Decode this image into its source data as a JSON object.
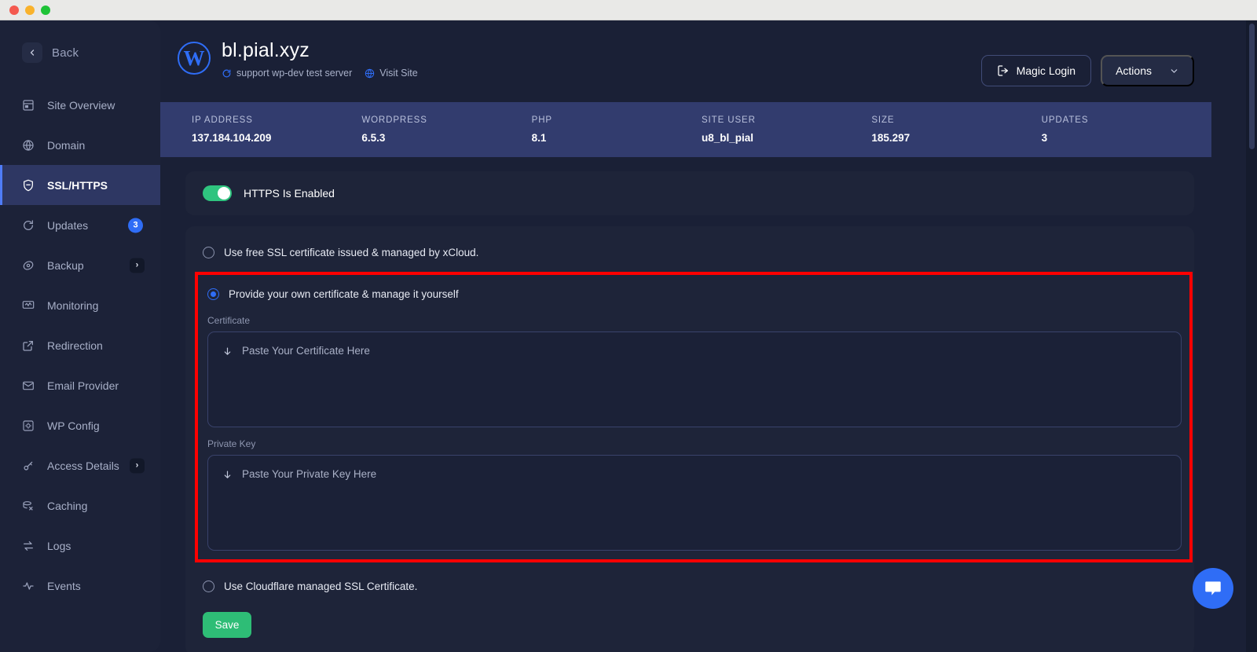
{
  "window": {
    "traffic_lights": [
      "close",
      "minimize",
      "maximize"
    ]
  },
  "sidebar": {
    "back_label": "Back",
    "items": [
      {
        "label": "Site Overview",
        "icon": "site-overview-icon",
        "active": false
      },
      {
        "label": "Domain",
        "icon": "domain-icon",
        "active": false
      },
      {
        "label": "SSL/HTTPS",
        "icon": "shield-icon",
        "active": true
      },
      {
        "label": "Updates",
        "icon": "refresh-icon",
        "active": false,
        "badge": "3"
      },
      {
        "label": "Backup",
        "icon": "backup-icon",
        "active": false,
        "chevron": "›"
      },
      {
        "label": "Monitoring",
        "icon": "monitoring-icon",
        "active": false
      },
      {
        "label": "Redirection",
        "icon": "external-link-icon",
        "active": false
      },
      {
        "label": "Email Provider",
        "icon": "envelope-icon",
        "active": false
      },
      {
        "label": "WP Config",
        "icon": "wp-config-icon",
        "active": false
      },
      {
        "label": "Access Details",
        "icon": "key-icon",
        "active": false,
        "chevron": "›"
      },
      {
        "label": "Caching",
        "icon": "caching-icon",
        "active": false
      },
      {
        "label": "Logs",
        "icon": "logs-icon",
        "active": false
      },
      {
        "label": "Events",
        "icon": "events-icon",
        "active": false
      }
    ]
  },
  "header": {
    "site_title": "bl.pial.xyz",
    "server_label": "support wp-dev test server",
    "visit_site_label": "Visit Site",
    "magic_login_label": "Magic Login",
    "actions_label": "Actions",
    "actions_chevron": "∨"
  },
  "stats": [
    {
      "label": "IP ADDRESS",
      "value": "137.184.104.209"
    },
    {
      "label": "WORDPRESS",
      "value": "6.5.3"
    },
    {
      "label": "PHP",
      "value": "8.1"
    },
    {
      "label": "SITE USER",
      "value": "u8_bl_pial"
    },
    {
      "label": "SIZE",
      "value": "185.297"
    },
    {
      "label": "UPDATES",
      "value": "3"
    }
  ],
  "https_card": {
    "toggle_state": "on",
    "label": "HTTPS Is Enabled"
  },
  "ssl_card": {
    "option_free": "Use free SSL certificate issued & managed by xCloud.",
    "option_own": "Provide your own certificate & manage it yourself",
    "option_cloudflare": "Use Cloudflare managed SSL Certificate.",
    "certificate_label": "Certificate",
    "certificate_placeholder": "Paste Your Certificate Here",
    "certificate_value": "",
    "private_key_label": "Private Key",
    "private_key_placeholder": "Paste Your Private Key Here",
    "private_key_value": "",
    "save_label": "Save",
    "selected_option": "own"
  },
  "colors": {
    "accent_blue": "#2f6df6",
    "toggle_green": "#2fc47f",
    "save_green": "#2ebd76",
    "highlight_red": "#ff0000",
    "sidebar_active": "#2e3763",
    "stats_strip": "#323c6e",
    "panel_bg": "#1a2036",
    "card_bg": "#1e2439"
  }
}
